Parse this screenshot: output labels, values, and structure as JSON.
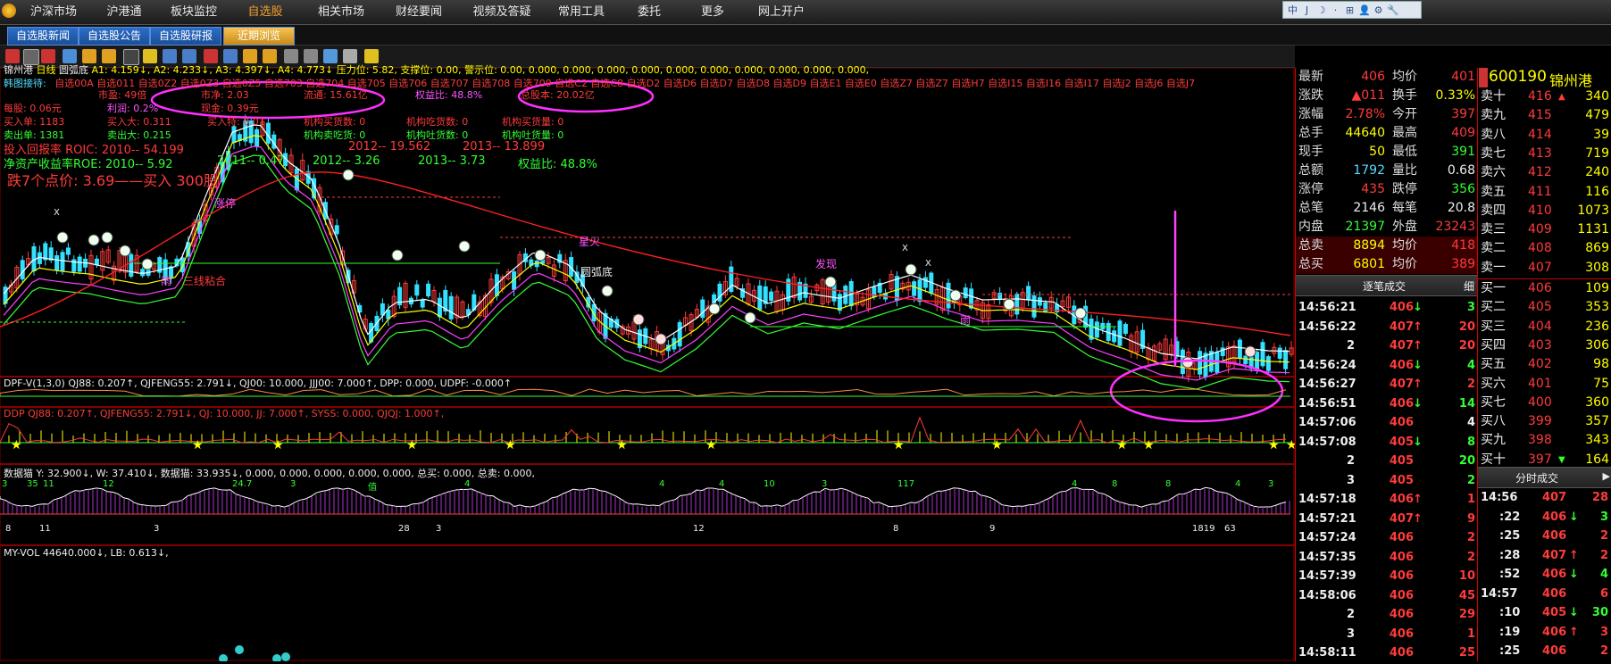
{
  "nav": {
    "tabs": [
      "沪深市场",
      "沪港通",
      "板块监控",
      "自选股",
      "相关市场",
      "财经要闻",
      "视频及答疑",
      "常用工具",
      "委托",
      "更多",
      "网上开户"
    ],
    "active_index": 3
  },
  "subnav": {
    "tabs": [
      "自选股新闻",
      "自选股公告",
      "自选股研报",
      "近期浏览"
    ],
    "active_index": 3
  },
  "window_tools": [
    "中",
    "J",
    "☽",
    "·",
    "⊞",
    "👤",
    "⚙",
    "🔧"
  ],
  "chart": {
    "header": "锦州港",
    "period": "日线",
    "indicator": "圆弧底",
    "info_line": "A1: 4.159↓, A2: 4.233↓, A3: 4.397↓, A4: 4.773↓ 压力位: 5.82, 支撑位: 0.00, 警示位: 0.00, 0.000, 0.000, 0.000, 0.000, 0.000, 0.000, 0.000, 0.000, 0.000, 0.000,",
    "info_row1": "韩图接待:",
    "info_row1_red": "自选00A  自选011  自选0Z2  自选0Z3  自选0Z5  自选703  自选704  自选705  自选706  自选707  自选708  自选709  自选C2  自选C8  自选D2  自选D6  自选D7  自选D8  自选D9  自选E1  自选E0  自选Z7  自选Z7  自选H7  自选I15  自选I16  自选I17  自选J2  自选J6  自选J7",
    "labels": {
      "pe": "市盈: 49倍",
      "mcap": "市净: 2.03",
      "float": "流通: 15.61亿",
      "roe_label": "权益比: 48.8%",
      "total_shares": "总股本: 20.02亿",
      "eps": "每股: 0.06元",
      "eps2": "利润: 0.2%",
      "cash": "现金: 0.39元",
      "buy": "买入单: 1183",
      "buy_big": "买入大: 0.311",
      "buy_in": "买入特: 0.01",
      "inst_buy": "机构买货数: 0",
      "inst_hold": "机构吃货数: 0",
      "inst_flow": "机构买货量: 0",
      "sell": "卖出单: 1381",
      "sell_big": "卖出大: 0.215",
      "inst_sell": "机构卖吃货: 0",
      "inst_out": "机构吐货数: 0",
      "inst_outv": "机构吐货量: 0",
      "roic": "投入回报率 ROIC: 2010-- 54.199",
      "roic2": "2012-- 19.562",
      "roic3": "2013-- 13.899",
      "roe": "净资产收益率ROE: 2010-- 5.92",
      "roe2": "2011-- 0.47",
      "roe3": "2012-- 3.26",
      "roe4": "2013-- 3.73",
      "equity": "权益比: 48.8%",
      "buy_hint": "跌7个点价: 3.69——买入  300股",
      "sanxian": "三线粘合",
      "yu": "雨",
      "yuanhu": "圆弧底",
      "xinghuo": "星火",
      "zhangting": "涨停",
      "faxian": "发现",
      "mai": "雨",
      "x1": "X",
      "x2": "X",
      "x3": "X"
    },
    "sub1_line": "DPF-V(1,3,0) QJ88: 0.207↑, QJFENG55: 2.791↓, QJ00: 10.000, JJJ00: 7.000↑, DPP: 0.000, UDPF: -0.000↑",
    "sub2_line": "DDP  QJ88: 0.207↑, QJFENG55: 2.791↓, QJ: 10.000, JJ: 7.000↑, SYSS: 0.000, QJQJ: 1.000↑,",
    "sub3_line": "数据猫  Y: 32.900↓, W: 37.410↓, 数据猫: 33.935↓, 0.000, 0.000, 0.000, 0.000, 0.000, 总买: 0.000, 总卖: 0.000,",
    "sub4_line": "MY-VOL  44640.000↓, LB: 0.613↓,",
    "sub3_labels": {
      "a": "3",
      "b": "35",
      "c": "11",
      "d": "12",
      "e": "24.7",
      "f": "3",
      "g": "值",
      "h": "4",
      "i": "4",
      "j": "4",
      "k": "10",
      "l": "3",
      "m": "117",
      "n": "4",
      "o": "8",
      "p": "8",
      "q": "4",
      "r": "3",
      "s": "8",
      "t": "11",
      "u": "3",
      "v": "12",
      "w": "8",
      "x": "9",
      "y": "28",
      "z": "3",
      "aa": "1819",
      "bb": "63"
    }
  },
  "stock": {
    "code": "600190",
    "name": "锦州港"
  },
  "quote": {
    "rows": [
      {
        "l1": "最新",
        "v1": "406",
        "c1": "#ff3b3b",
        "l2": "均价",
        "v2": "401",
        "c2": "#ff3b3b"
      },
      {
        "l1": "涨跌",
        "v1": "▲011",
        "c1": "#ff3b3b",
        "l2": "换手",
        "v2": "0.33%",
        "c2": "#ffff00"
      },
      {
        "l1": "涨幅",
        "v1": "2.78%",
        "c1": "#ff3b3b",
        "l2": "今开",
        "v2": "397",
        "c2": "#ff3b3b"
      },
      {
        "l1": "总手",
        "v1": "44640",
        "c1": "#ffff00",
        "l2": "最高",
        "v2": "409",
        "c2": "#ff3b3b"
      },
      {
        "l1": "现手",
        "v1": "50",
        "c1": "#ffff00",
        "l2": "最低",
        "v2": "391",
        "c2": "#33ff33"
      },
      {
        "l1": "总额",
        "v1": "1792",
        "c1": "#55ddff",
        "l2": "量比",
        "v2": "0.68",
        "c2": "#eeeeee"
      },
      {
        "l1": "涨停",
        "v1": "435",
        "c1": "#ff3b3b",
        "l2": "跌停",
        "v2": "356",
        "c2": "#33ff33"
      },
      {
        "l1": "总笔",
        "v1": "2146",
        "c1": "#eeeeee",
        "l2": "每笔",
        "v2": "20.8",
        "c2": "#eeeeee"
      },
      {
        "l1": "内盘",
        "v1": "21397",
        "c1": "#33ff33",
        "l2": "外盘",
        "v2": "23243",
        "c2": "#ff3b3b"
      },
      {
        "l1": "总卖",
        "v1": "8894",
        "c1": "#ffff00",
        "l2": "均价",
        "v2": "418",
        "c2": "#ff3b3b"
      },
      {
        "l1": "总买",
        "v1": "6801",
        "c1": "#ffff00",
        "l2": "均价",
        "v2": "389",
        "c2": "#ff3b3b"
      }
    ],
    "tick_title": "逐笔成交",
    "tick_btn": "细",
    "ticks": [
      {
        "t": "14:56:21",
        "p": "406",
        "d": "↓",
        "v": "3",
        "pc": "#ff3b3b",
        "dc": "#33ff33",
        "vc": "#33ff33"
      },
      {
        "t": "14:56:22",
        "p": "407",
        "d": "↑",
        "v": "20",
        "pc": "#ff3b3b",
        "dc": "#ff3b3b",
        "vc": "#ff3b3b"
      },
      {
        "t": "2",
        "p": "407",
        "d": "↑",
        "v": "20",
        "pc": "#ff3b3b",
        "dc": "#ff3b3b",
        "vc": "#ff3b3b"
      },
      {
        "t": "14:56:24",
        "p": "406",
        "d": "↓",
        "v": "4",
        "pc": "#ff3b3b",
        "dc": "#33ff33",
        "vc": "#33ff33"
      },
      {
        "t": "14:56:27",
        "p": "407",
        "d": "↑",
        "v": "2",
        "pc": "#ff3b3b",
        "dc": "#ff3b3b",
        "vc": "#ff3b3b"
      },
      {
        "t": "14:56:51",
        "p": "406",
        "d": "↓",
        "v": "14",
        "pc": "#ff3b3b",
        "dc": "#33ff33",
        "vc": "#33ff33"
      },
      {
        "t": "14:57:06",
        "p": "406",
        "d": "",
        "v": "4",
        "pc": "#ff3b3b",
        "dc": "#33ff33",
        "vc": "#eeeeee"
      },
      {
        "t": "14:57:08",
        "p": "405",
        "d": "↓",
        "v": "8",
        "pc": "#ff3b3b",
        "dc": "#33ff33",
        "vc": "#33ff33"
      },
      {
        "t": "2",
        "p": "405",
        "d": "",
        "v": "20",
        "pc": "#ff3b3b",
        "dc": "#33ff33",
        "vc": "#33ff33"
      },
      {
        "t": "3",
        "p": "405",
        "d": "",
        "v": "2",
        "pc": "#ff3b3b",
        "dc": "#33ff33",
        "vc": "#33ff33"
      },
      {
        "t": "14:57:18",
        "p": "406",
        "d": "↑",
        "v": "1",
        "pc": "#ff3b3b",
        "dc": "#ff3b3b",
        "vc": "#ff3b3b"
      },
      {
        "t": "14:57:21",
        "p": "407",
        "d": "↑",
        "v": "9",
        "pc": "#ff3b3b",
        "dc": "#ff3b3b",
        "vc": "#ff3b3b"
      },
      {
        "t": "14:57:24",
        "p": "406",
        "d": "",
        "v": "2",
        "pc": "#ff3b3b",
        "dc": "#33ff33",
        "vc": "#ff3b3b"
      },
      {
        "t": "14:57:35",
        "p": "406",
        "d": "",
        "v": "2",
        "pc": "#ff3b3b",
        "dc": "#33ff33",
        "vc": "#ff3b3b"
      },
      {
        "t": "14:57:39",
        "p": "406",
        "d": "",
        "v": "10",
        "pc": "#ff3b3b",
        "dc": "#33ff33",
        "vc": "#ff3b3b"
      },
      {
        "t": "14:58:06",
        "p": "406",
        "d": "",
        "v": "45",
        "pc": "#ff3b3b",
        "dc": "#33ff33",
        "vc": "#ff3b3b"
      },
      {
        "t": "2",
        "p": "406",
        "d": "",
        "v": "29",
        "pc": "#ff3b3b",
        "dc": "#33ff33",
        "vc": "#ff3b3b"
      },
      {
        "t": "3",
        "p": "406",
        "d": "",
        "v": "1",
        "pc": "#ff3b3b",
        "dc": "#33ff33",
        "vc": "#ff3b3b"
      },
      {
        "t": "14:58:11",
        "p": "406",
        "d": "",
        "v": "25",
        "pc": "#ff3b3b",
        "dc": "#33ff33",
        "vc": "#ff3b3b"
      }
    ]
  },
  "orderbook": {
    "sells": [
      {
        "l": "卖十",
        "p": "416",
        "m": "▲",
        "v": "340"
      },
      {
        "l": "卖九",
        "p": "415",
        "m": "",
        "v": "479"
      },
      {
        "l": "卖八",
        "p": "414",
        "m": "",
        "v": "39"
      },
      {
        "l": "卖七",
        "p": "413",
        "m": "",
        "v": "719"
      },
      {
        "l": "卖六",
        "p": "412",
        "m": "",
        "v": "240"
      },
      {
        "l": "卖五",
        "p": "411",
        "m": "",
        "v": "116"
      },
      {
        "l": "卖四",
        "p": "410",
        "m": "",
        "v": "1073"
      },
      {
        "l": "卖三",
        "p": "409",
        "m": "",
        "v": "1131"
      },
      {
        "l": "卖二",
        "p": "408",
        "m": "",
        "v": "869"
      },
      {
        "l": "卖一",
        "p": "407",
        "m": "",
        "v": "308"
      }
    ],
    "buys": [
      {
        "l": "买一",
        "p": "406",
        "m": "",
        "v": "109"
      },
      {
        "l": "买二",
        "p": "405",
        "m": "",
        "v": "353"
      },
      {
        "l": "买三",
        "p": "404",
        "m": "",
        "v": "236"
      },
      {
        "l": "买四",
        "p": "403",
        "m": "",
        "v": "306"
      },
      {
        "l": "买五",
        "p": "402",
        "m": "",
        "v": "98"
      },
      {
        "l": "买六",
        "p": "401",
        "m": "",
        "v": "75"
      },
      {
        "l": "买七",
        "p": "400",
        "m": "",
        "v": "360"
      },
      {
        "l": "买八",
        "p": "399",
        "m": "",
        "v": "357"
      },
      {
        "l": "买九",
        "p": "398",
        "m": "",
        "v": "343"
      },
      {
        "l": "买十",
        "p": "397",
        "m": "▼",
        "v": "164"
      }
    ],
    "min_title": "分时成交",
    "minutes": [
      {
        "t": "14:56",
        "p": "407",
        "d": "",
        "v": "28",
        "vc": "#ff3b3b"
      },
      {
        "t": ":22",
        "p": "406",
        "d": "↓",
        "v": "3",
        "vc": "#33ff33"
      },
      {
        "t": ":25",
        "p": "406",
        "d": "",
        "v": "2",
        "vc": "#ff3b3b"
      },
      {
        "t": ":28",
        "p": "407",
        "d": "↑",
        "v": "2",
        "vc": "#ff3b3b"
      },
      {
        "t": ":52",
        "p": "406",
        "d": "↓",
        "v": "4",
        "vc": "#33ff33"
      },
      {
        "t": "14:57",
        "p": "406",
        "d": "",
        "v": "6",
        "vc": "#ff3b3b"
      },
      {
        "t": ":10",
        "p": "405",
        "d": "↓",
        "v": "30",
        "vc": "#33ff33"
      },
      {
        "t": ":19",
        "p": "406",
        "d": "↑",
        "v": "3",
        "vc": "#ff3b3b"
      },
      {
        "t": ":25",
        "p": "406",
        "d": "",
        "v": "2",
        "vc": "#ff3b3b"
      }
    ]
  }
}
